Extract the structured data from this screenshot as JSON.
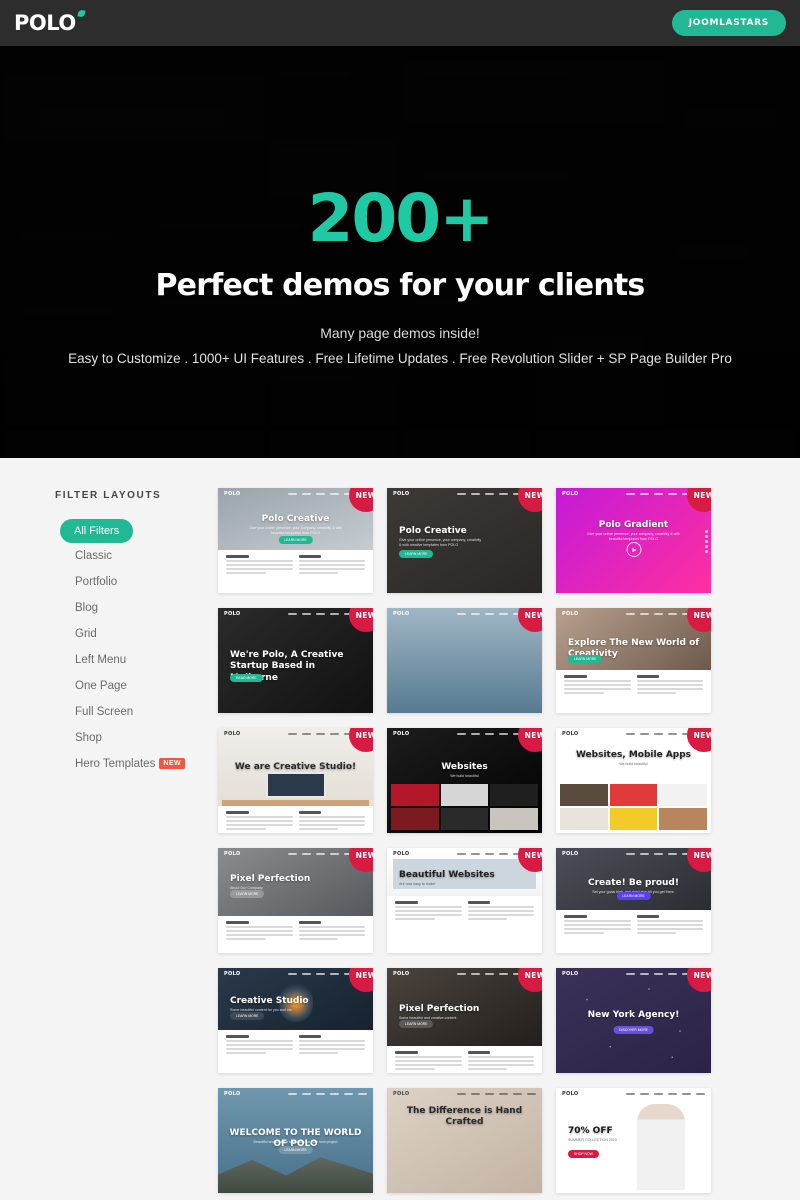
{
  "topbar": {
    "logo_text": "POLO",
    "cta_label": "JOOMLASTARS"
  },
  "hero": {
    "headline_number": "200+",
    "headline": "Perfect demos for your clients",
    "subtitle": "Many page demos inside!",
    "features": "Easy to Customize . 1000+ UI Features . Free Lifetime Updates . Free Revolution Slider + SP Page Builder Pro"
  },
  "sidebar": {
    "title": "FILTER LAYOUTS",
    "items": [
      {
        "label": "All Filters",
        "active": true,
        "badge": ""
      },
      {
        "label": "Classic",
        "active": false,
        "badge": ""
      },
      {
        "label": "Portfolio",
        "active": false,
        "badge": ""
      },
      {
        "label": "Blog",
        "active": false,
        "badge": ""
      },
      {
        "label": "Grid",
        "active": false,
        "badge": ""
      },
      {
        "label": "Left Menu",
        "active": false,
        "badge": ""
      },
      {
        "label": "One Page",
        "active": false,
        "badge": ""
      },
      {
        "label": "Full Screen",
        "active": false,
        "badge": ""
      },
      {
        "label": "Shop",
        "active": false,
        "badge": ""
      },
      {
        "label": "Hero Templates",
        "active": false,
        "badge": "NEW"
      }
    ]
  },
  "colors": {
    "accent_teal": "#21b894",
    "badge_red": "#d81b43",
    "new_orange": "#f2563d",
    "topbar_dark": "#2d2d2d",
    "page_bg": "#f4f4f4"
  },
  "grid": {
    "badge_label": "NEW",
    "cards": [
      {
        "logo": "POLO",
        "title": "Polo Creative",
        "subtitle": "Give your online presence, your company, creativity & with beautiful templates from POLO",
        "badge": true,
        "btn": "LEARN MORE"
      },
      {
        "logo": "POLO",
        "title": "Polo Creative",
        "subtitle": "Give your online presence, your company, creativity & with creative templates from POLO",
        "badge": true,
        "btn": "LEARN MORE"
      },
      {
        "logo": "POLO",
        "title": "Polo Gradient",
        "subtitle": "Give your online presence, your company, creativity & with beautiful templates from POLO",
        "badge": true,
        "btn": ""
      },
      {
        "logo": "POLO",
        "title": "We're Polo, A Creative Startup Based in Melburne",
        "subtitle": "",
        "badge": true,
        "btn": "READ MORE"
      },
      {
        "logo": "POLO",
        "title": "",
        "subtitle": "",
        "badge": true,
        "btn": ""
      },
      {
        "logo": "POLO",
        "title": "Explore The New World of Creativity",
        "subtitle": "",
        "badge": true,
        "btn": "LEARN MORE"
      },
      {
        "logo": "POLO",
        "title": "We are Creative Studio!",
        "subtitle": "",
        "badge": true,
        "btn": ""
      },
      {
        "logo": "POLO",
        "title": "Websites",
        "subtitle": "We build beautiful",
        "badge": true,
        "btn": ""
      },
      {
        "logo": "POLO",
        "title": "Websites, Mobile Apps",
        "subtitle": "We build beautiful",
        "badge": true,
        "btn": ""
      },
      {
        "logo": "POLO",
        "title": "Pixel Perfection",
        "subtitle": "About Our Company",
        "badge": true,
        "btn": "LEARN MORE"
      },
      {
        "logo": "POLO",
        "title": "Beautiful Websites",
        "subtitle": "Are now easy to make!",
        "badge": true,
        "btn": ""
      },
      {
        "logo": "POLO",
        "title": "Create! Be proud!",
        "subtitle": "Set your goals high, and don't stop till you get there.",
        "badge": true,
        "btn": "LEARN MORE"
      },
      {
        "logo": "POLO",
        "title": "Creative Studio",
        "subtitle": "Some beautiful content for you and me",
        "badge": true,
        "btn": "LEARN MORE"
      },
      {
        "logo": "POLO",
        "title": "Pixel Perfection",
        "subtitle": "Some beautiful and creative content",
        "badge": true,
        "btn": "LEARN MORE"
      },
      {
        "logo": "POLO",
        "title": "New York Agency!",
        "subtitle": "",
        "badge": true,
        "btn": "DISCOVER MORE"
      },
      {
        "logo": "POLO",
        "title": "WELCOME TO THE WORLD OF POLO",
        "subtitle": "Beautiful and creative templates for your next project",
        "badge": false,
        "btn": "LEARN MORE"
      },
      {
        "logo": "POLO",
        "title": "The Difference is Hand Crafted",
        "subtitle": "",
        "badge": false,
        "btn": ""
      },
      {
        "logo": "POLO",
        "title": "70% OFF",
        "subtitle": "SUMMER COLLECTION 2015",
        "badge": false,
        "btn": "SHOP NOW"
      }
    ]
  }
}
